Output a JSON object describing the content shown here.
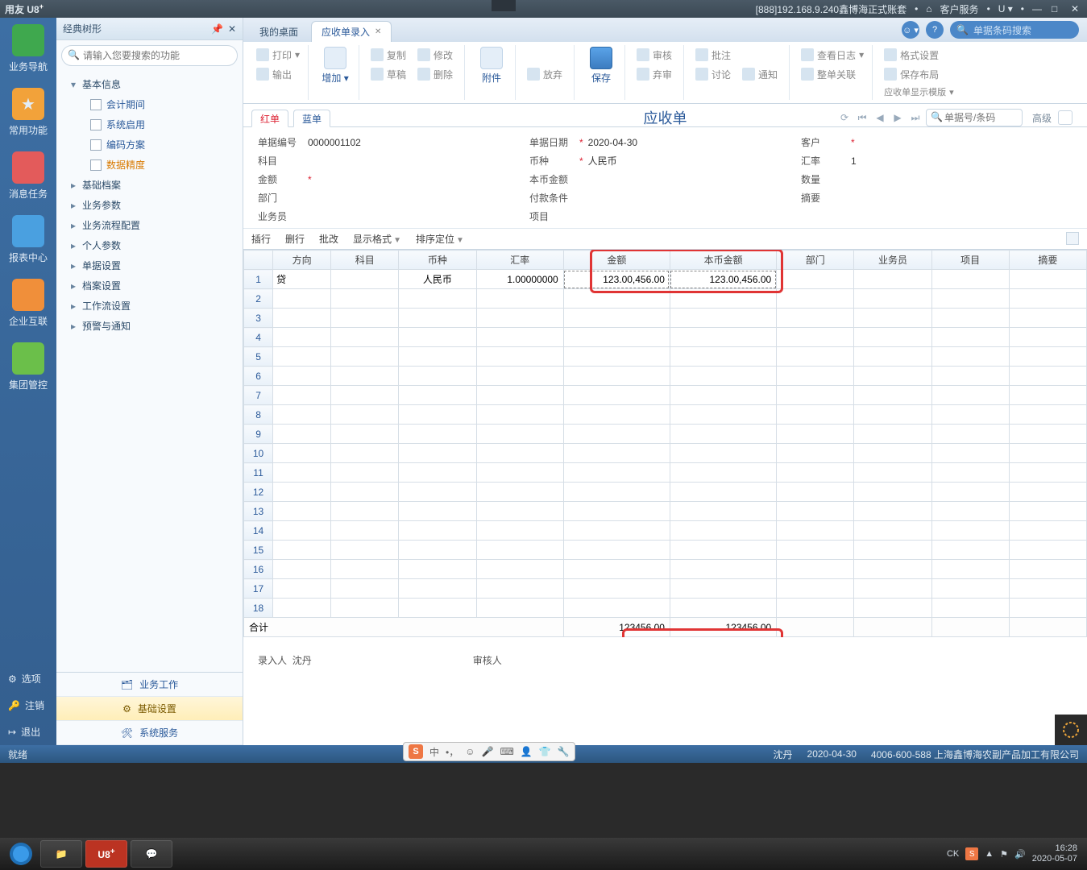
{
  "titlebar": {
    "brand": "用友 U8",
    "brand_sup": "+",
    "session": "[888]192.168.9.240鑫博海正式账套",
    "service_label": "客户服务",
    "u_label": "U"
  },
  "rail": {
    "items": [
      {
        "label": "业务导航",
        "color": "#3fa84e"
      },
      {
        "label": "常用功能",
        "color": "#f2a23a"
      },
      {
        "label": "消息任务",
        "color": "#e35b5b"
      },
      {
        "label": "报表中心",
        "color": "#4aa0e0"
      },
      {
        "label": "企业互联",
        "color": "#f08f3a"
      },
      {
        "label": "集团管控",
        "color": "#6bbf4a"
      }
    ],
    "bottom": [
      {
        "label": "选项",
        "icon": "⚙"
      },
      {
        "label": "注销",
        "icon": "🔑"
      },
      {
        "label": "退出",
        "icon": "↪"
      }
    ]
  },
  "tree": {
    "title": "经典树形",
    "search_placeholder": "请输入您要搜索的功能",
    "root": "基本信息",
    "leaves": [
      "会计期间",
      "系统启用",
      "编码方案",
      "数据精度"
    ],
    "folders": [
      "基础档案",
      "业务参数",
      "业务流程配置",
      "个人参数",
      "单据设置",
      "档案设置",
      "工作流设置",
      "预警与通知"
    ],
    "bottom_tabs": [
      "业务工作",
      "基础设置",
      "系统服务"
    ]
  },
  "tabs": {
    "desktop": "我的桌面",
    "active": "应收单录入"
  },
  "tabbar_right": {
    "search_placeholder": "单据条码搜索"
  },
  "toolbar": {
    "print": "打印",
    "export": "输出",
    "add": "增加",
    "copy": "复制",
    "edit": "修改",
    "draft": "草稿",
    "delete": "删除",
    "attach": "附件",
    "abandon": "放弃",
    "save": "保存",
    "audit": "审核",
    "deaudit": "弃审",
    "approve": "批注",
    "discuss": "讨论",
    "notify": "通知",
    "log": "查看日志",
    "close_link": "整单关联",
    "format": "格式设置",
    "save_layout": "保存布局",
    "template": "应收单显示模版"
  },
  "rbtabs": {
    "red": "红单",
    "blue": "蓝单",
    "title": "应收单",
    "barcode_placeholder": "单据号/条码",
    "advanced": "高级"
  },
  "form": {
    "doc_no_label": "单据编号",
    "doc_no": "0000001102",
    "date_label": "单据日期",
    "date": "2020-04-30",
    "customer_label": "客户",
    "subject_label": "科目",
    "currency_label": "币种",
    "currency": "人民币",
    "rate_label": "汇率",
    "rate": "1",
    "amount_label": "金额",
    "local_amount_label": "本币金额",
    "qty_label": "数量",
    "dept_label": "部门",
    "pay_term_label": "付款条件",
    "summary_label": "摘要",
    "sales_label": "业务员",
    "project_label": "项目"
  },
  "grid_tools": {
    "insert": "插行",
    "delete": "删行",
    "batch": "批改",
    "format": "显示格式",
    "sort": "排序定位"
  },
  "table": {
    "headers": [
      "方向",
      "科目",
      "币种",
      "汇率",
      "金额",
      "本币金额",
      "部门",
      "业务员",
      "项目",
      "摘要"
    ],
    "row1": {
      "dir": "贷",
      "currency": "人民币",
      "rate": "1.00000000",
      "amount": "123.00,456.00",
      "local": "123.00,456.00"
    },
    "sum_label": "合计",
    "sum_amount": "123456.00",
    "sum_local": "123456.00"
  },
  "footer": {
    "entry_label": "录入人",
    "entry_person": "沈丹",
    "audit_label": "审核人"
  },
  "status": {
    "ready": "就绪",
    "user": "沈丹",
    "date": "2020-04-30",
    "hotline": "4006-600-588 上海鑫博海农副产品加工有限公司"
  },
  "ime": {
    "s": "S",
    "zhong": "中"
  },
  "taskbar": {
    "time": "16:28",
    "date": "2020-05-07",
    "ck": "CK"
  }
}
